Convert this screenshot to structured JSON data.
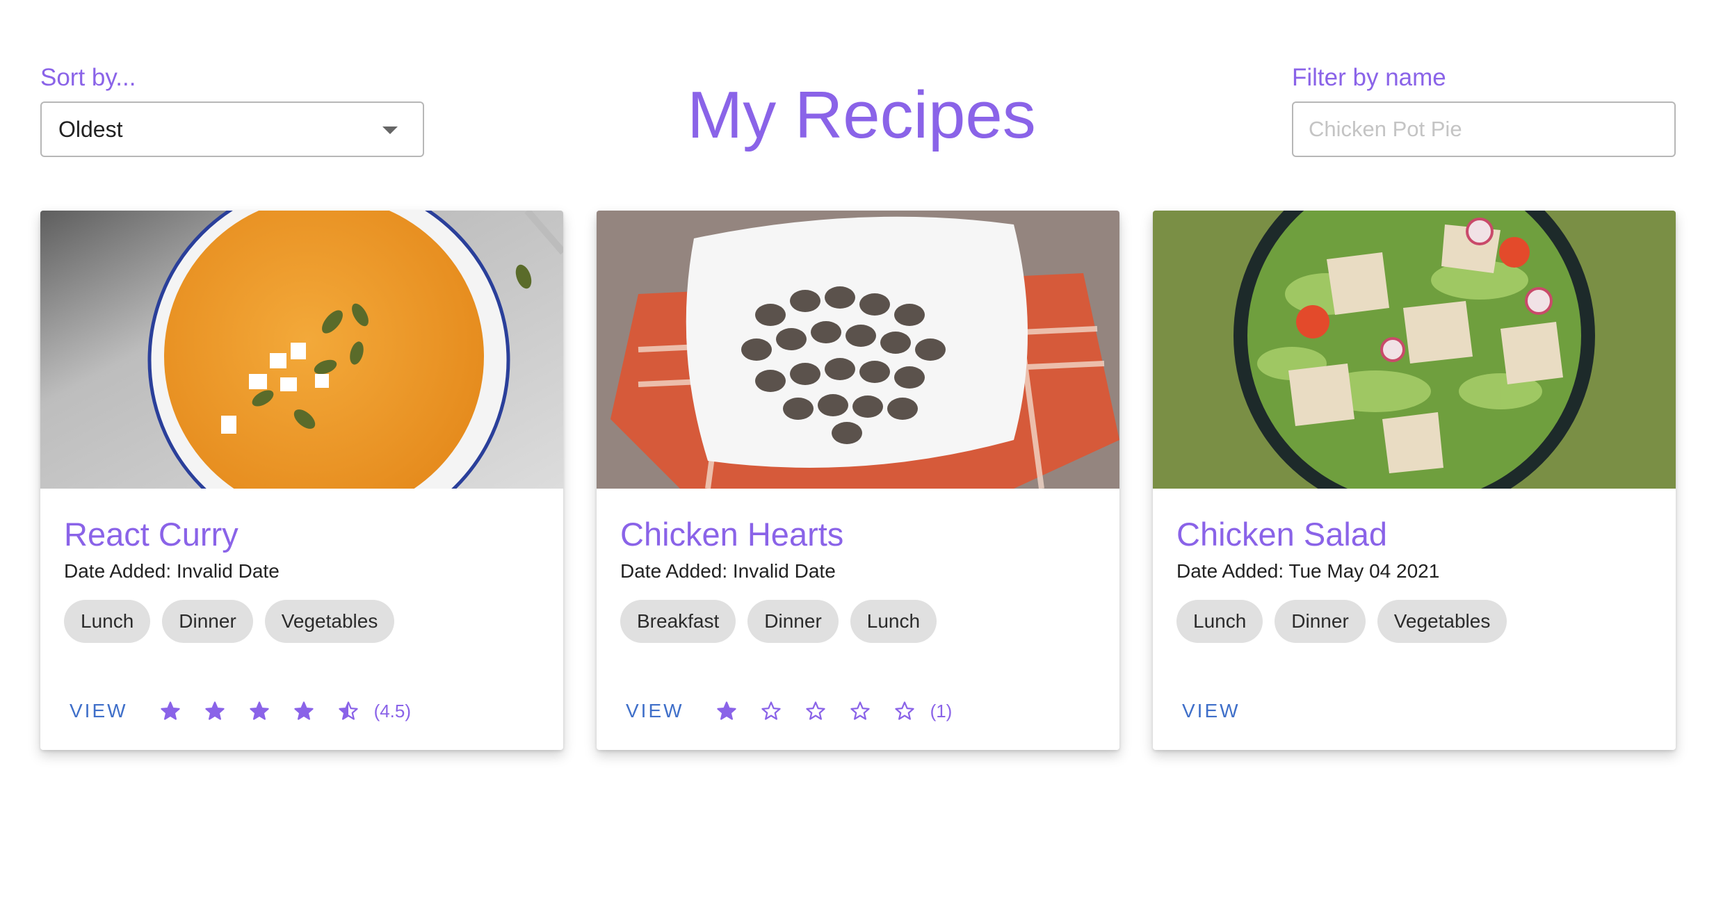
{
  "header": {
    "title": "My Recipes",
    "sort_label": "Sort by...",
    "sort_value": "Oldest",
    "filter_label": "Filter by name",
    "filter_placeholder": "Chicken Pot Pie",
    "filter_value": ""
  },
  "date_prefix": "Date Added: ",
  "view_label": "VIEW",
  "accent_color": "#8a63e8",
  "link_color": "#3f6fc9",
  "cards": [
    {
      "title": "React Curry",
      "date": "Invalid Date",
      "tags": [
        "Lunch",
        "Dinner",
        "Vegetables"
      ],
      "rating": 4.5,
      "rating_label": "(4.5)",
      "image": "orange-soup-bowl-photo"
    },
    {
      "title": "Chicken Hearts",
      "date": "Invalid Date",
      "tags": [
        "Breakfast",
        "Dinner",
        "Lunch"
      ],
      "rating": 1,
      "rating_label": "(1)",
      "image": "chicken-hearts-plate-photo"
    },
    {
      "title": "Chicken Salad",
      "date": "Tue May 04 2021",
      "tags": [
        "Lunch",
        "Dinner",
        "Vegetables"
      ],
      "rating": null,
      "rating_label": "",
      "image": "chicken-salad-bowl-photo"
    }
  ]
}
